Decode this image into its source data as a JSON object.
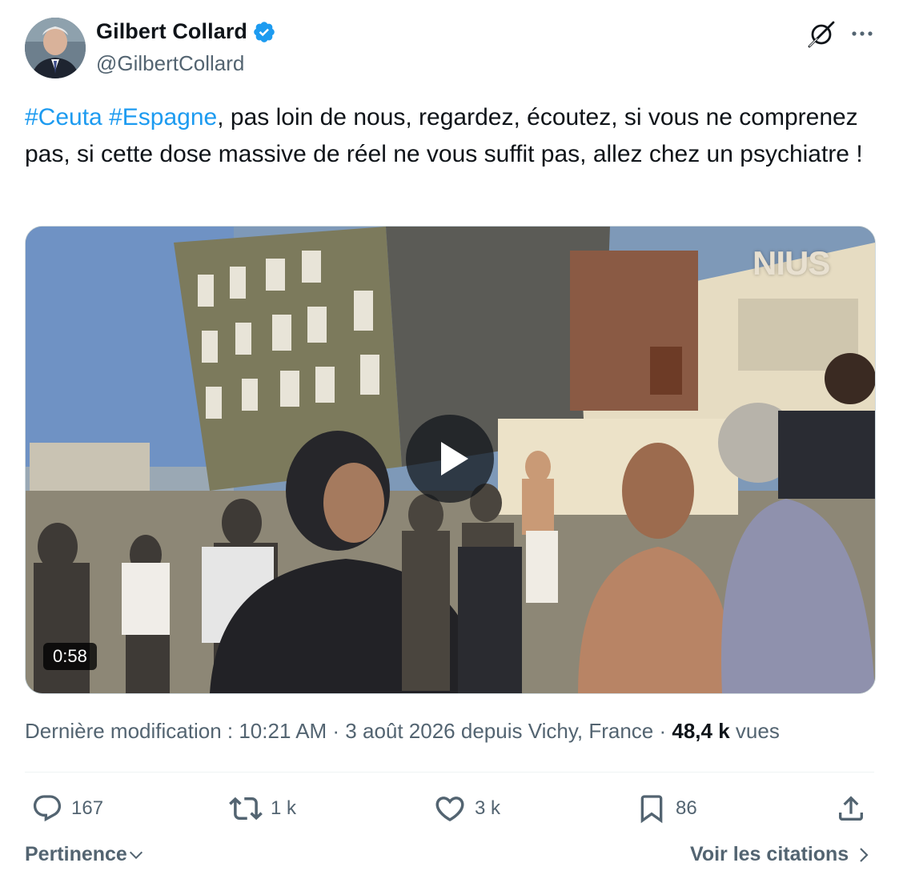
{
  "author": {
    "name": "Gilbert Collard",
    "handle": "@GilbertCollard",
    "verified": true
  },
  "header_icons": [
    "grok-icon",
    "more-icon"
  ],
  "tweet": {
    "hashtag_1": "#Ceuta",
    "hashtag_2": "#Espagne",
    "text": ", pas loin de nous, regardez, écoutez, si vous ne comprenez pas, si cette dose massive de réel ne vous suffit pas, allez chez un psychiatre !"
  },
  "media": {
    "duration": "0:58",
    "watermark": "NIUS"
  },
  "meta": {
    "edited_label": "Dernière modification : 10:21 AM · 3 août 2026 depuis Vichy, France · ",
    "views_count": "48,4 k",
    "views_label": " vues"
  },
  "actions": {
    "replies": "167",
    "reposts": "1 k",
    "likes": "3 k",
    "bookmarks": "86"
  },
  "footer": {
    "sort_label": "Pertinence",
    "quotes_label": "Voir les citations"
  },
  "colors": {
    "accent": "#1d9bf0",
    "secondary_text": "#536471",
    "primary_text": "#0f1419"
  }
}
